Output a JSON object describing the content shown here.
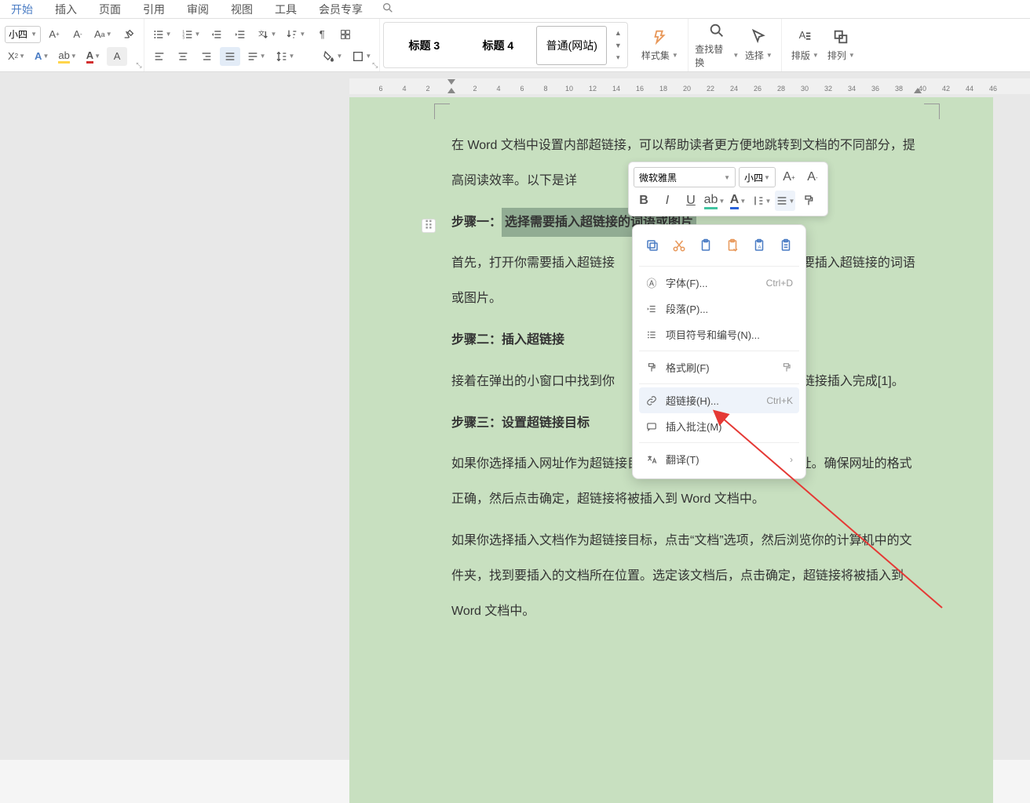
{
  "menu": {
    "tabs": [
      "开始",
      "插入",
      "页面",
      "引用",
      "审阅",
      "视图",
      "工具",
      "会员专享"
    ],
    "active_index": 0
  },
  "ribbon": {
    "font_size": "小四",
    "styles": {
      "heading3": "标题 3",
      "heading4": "标题 4",
      "normal_web": "普通(网站)"
    },
    "style_set": "样式集",
    "find_replace": "查找替换",
    "select": "选择",
    "layout": "排版",
    "arrange": "排列"
  },
  "ruler": {
    "ticks": [
      6,
      4,
      2,
      2,
      4,
      6,
      8,
      10,
      12,
      14,
      16,
      18,
      20,
      22,
      24,
      26,
      28,
      30,
      32,
      34,
      36,
      38,
      40,
      42,
      44,
      46
    ]
  },
  "document": {
    "p1": "在 Word 文档中设置内部超链接，可以帮助读者更方便地跳转到文档的不同部分，提高阅读效率。以下是详",
    "step1_label": "步骤一：",
    "step1_sel": "选择需要插入超链接的词语或图片",
    "p2a": "首先，打开你需要插入超链接",
    "p2b": "要插入超链接的词语或图片。",
    "step2": "步骤二：插入超链接",
    "p3a": "接着在弹出的小窗口中找到你",
    "p3b": "链接插入完成[1]。",
    "step3": "步骤三：设置超链接目标",
    "p4": "如果你选择插入网址作为超链接目标，直接在“地址”栏中输入网址。确保网址的格式正确，然后点击确定，超链接将被插入到 Word 文档中。",
    "p5": "如果你选择插入文档作为超链接目标，点击“文档”选项，然后浏览你的计算机中的文件夹，找到要插入的文档所在位置。选定该文档后，点击确定，超链接将被插入到 Word 文档中。"
  },
  "mini_toolbar": {
    "font_name": "微软雅黑",
    "font_size": "小四"
  },
  "context_menu": {
    "font": "字体(F)...",
    "font_sc": "Ctrl+D",
    "paragraph": "段落(P)...",
    "bullets": "项目符号和编号(N)...",
    "format_painter": "格式刷(F)",
    "hyperlink": "超链接(H)...",
    "hyperlink_sc": "Ctrl+K",
    "comment": "插入批注(M)",
    "translate": "翻译(T)"
  }
}
